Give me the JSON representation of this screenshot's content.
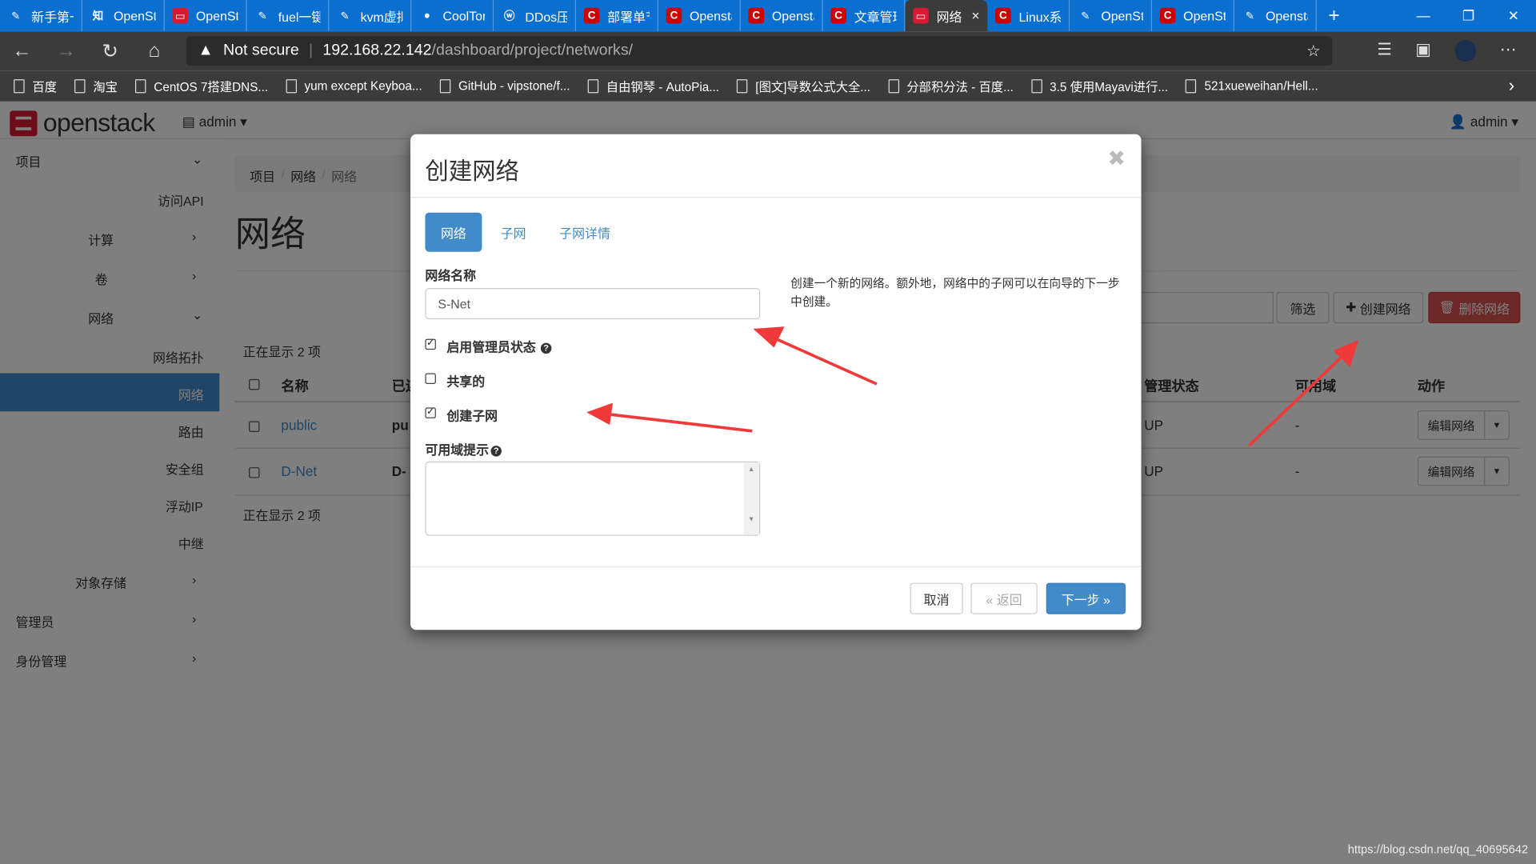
{
  "browser": {
    "tabs": [
      {
        "label": "新手第一",
        "icon": "feather-icon",
        "color": "#0a6fcf"
      },
      {
        "label": "OpenSta",
        "icon": "zhihu-icon",
        "color": "#0a6fcf"
      },
      {
        "label": "OpenSta",
        "icon": "openstack-icon",
        "color": "#da1a32"
      },
      {
        "label": "fuel一键",
        "icon": "feather-icon",
        "color": "#0a6fcf"
      },
      {
        "label": "kvm虚拟",
        "icon": "feather-icon",
        "color": "#0a6fcf"
      },
      {
        "label": "CoolTon",
        "icon": "github-icon",
        "color": "#0a6fcf"
      },
      {
        "label": "DDos压",
        "icon": "wordpress-icon",
        "color": "#0a6fcf"
      },
      {
        "label": "部署单节",
        "icon": "csdn-icon",
        "color": "#c00"
      },
      {
        "label": "Opensta",
        "icon": "csdn-icon",
        "color": "#c00"
      },
      {
        "label": "Opensta",
        "icon": "csdn-icon",
        "color": "#c00"
      },
      {
        "label": "文章管理",
        "icon": "csdn-icon",
        "color": "#c00"
      },
      {
        "label": "网络",
        "icon": "openstack-icon",
        "color": "#da1a32",
        "active": true
      },
      {
        "label": "Linux系统",
        "icon": "csdn-icon",
        "color": "#c00"
      },
      {
        "label": "OpenSta",
        "icon": "feather-icon",
        "color": "#0a6fcf"
      },
      {
        "label": "OpenSta",
        "icon": "csdn-icon",
        "color": "#c00"
      },
      {
        "label": "Opensta",
        "icon": "feather-icon",
        "color": "#0a6fcf"
      }
    ],
    "security": "Not secure",
    "url_host": "192.168.22.142",
    "url_path": "/dashboard/project/networks/",
    "bookmarks": [
      "百度",
      "淘宝",
      "CentOS 7搭建DNS...",
      "yum except Keyboa...",
      "GitHub - vipstone/f...",
      "自由钢琴 - AutoPia...",
      "[图文]导数公式大全...",
      "分部积分法 - 百度...",
      "3.5 使用Mayavi进行...",
      "521xueweihan/Hell..."
    ]
  },
  "header": {
    "logo": "openstack",
    "project": "admin",
    "user": "admin"
  },
  "sidebar": {
    "project": "项目",
    "api": "访问API",
    "compute": "计算",
    "volumes": "卷",
    "network": "网络",
    "topology": "网络拓扑",
    "networks": "网络",
    "routers": "路由",
    "security_groups": "安全组",
    "floating_ips": "浮动IP",
    "trunks": "中继",
    "object_store": "对象存储",
    "admin": "管理员",
    "identity": "身份管理"
  },
  "page": {
    "breadcrumb": [
      "项目",
      "网络",
      "网络"
    ],
    "title": "网络",
    "filter_label": "筛选",
    "create_label": "创建网络",
    "delete_label": "删除网络",
    "count_top": "正在显示 2 项",
    "count_bottom": "正在显示 2 项",
    "columns": [
      "名称",
      "已连",
      "管理状态",
      "可用域",
      "动作"
    ],
    "rows": [
      {
        "name": "public",
        "subnet": "pu",
        "admin_state": "UP",
        "az": "-",
        "action": "编辑网络"
      },
      {
        "name": "D-Net",
        "subnet": "D-",
        "admin_state": "UP",
        "az": "-",
        "action": "编辑网络"
      }
    ]
  },
  "modal": {
    "title": "创建网络",
    "tabs": [
      "网络",
      "子网",
      "子网详情"
    ],
    "name_label": "网络名称",
    "name_value": "S-Net",
    "admin_state_label": "启用管理员状态",
    "admin_state_checked": true,
    "shared_label": "共享的",
    "shared_checked": false,
    "create_subnet_label": "创建子网",
    "create_subnet_checked": true,
    "az_label": "可用域提示",
    "description": "创建一个新的网络。额外地，网络中的子网可以在向导的下一步中创建。",
    "cancel": "取消",
    "back": "« 返回",
    "next": "下一步 »"
  },
  "watermark": "https://blog.csdn.net/qq_40695642",
  "colors": {
    "primary": "#428bca",
    "danger": "#d9534f",
    "annotation_arrow": "#f03a3a"
  }
}
